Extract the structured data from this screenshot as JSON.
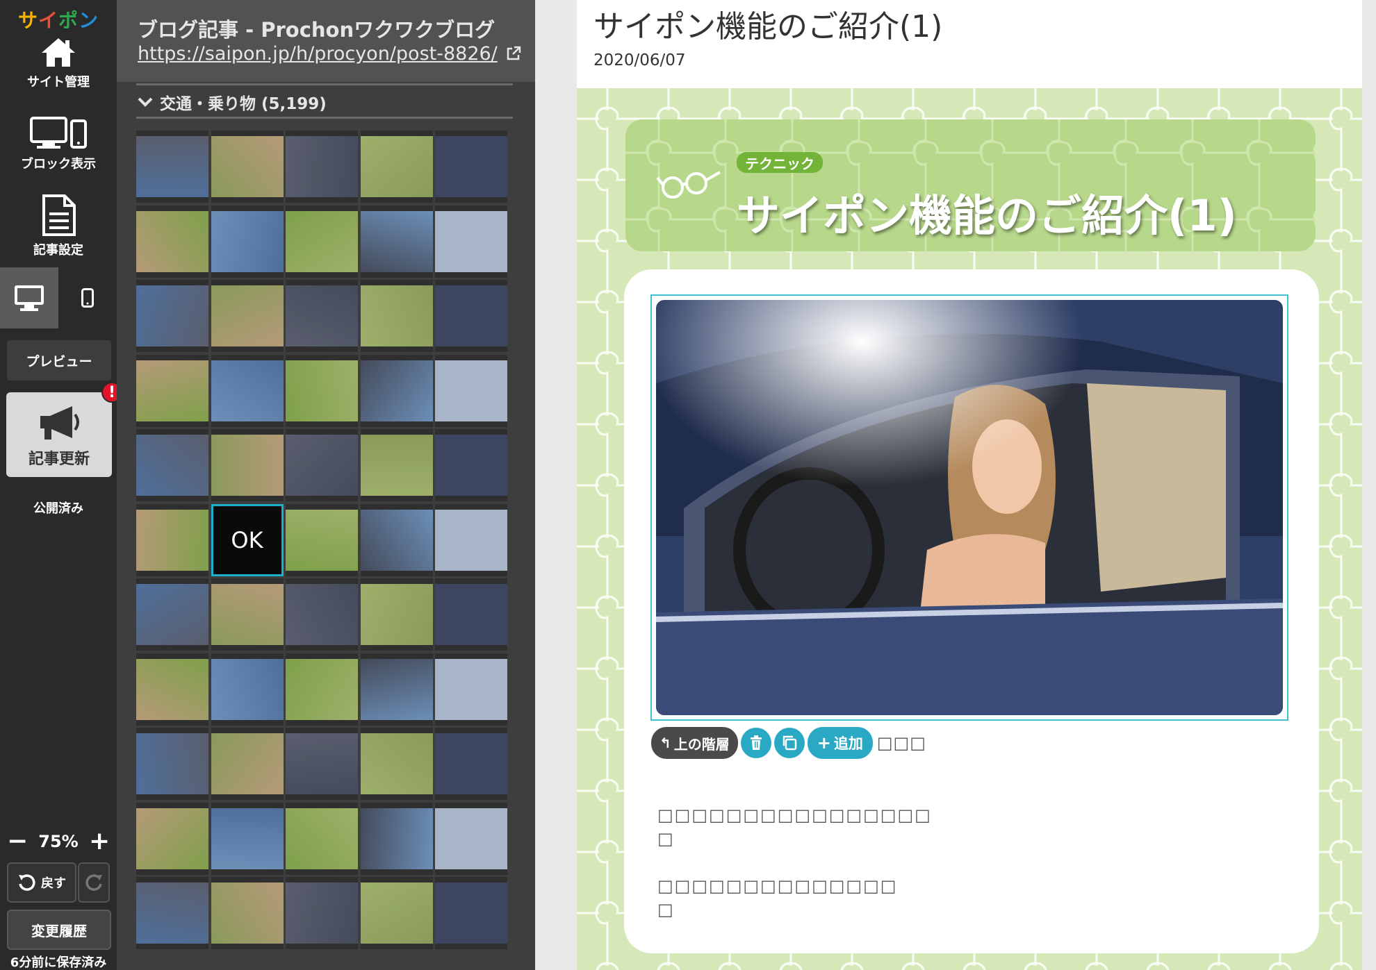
{
  "nav": {
    "logo": [
      "サ",
      "イ",
      "ポ",
      "ン"
    ],
    "site_manage": "サイト管理",
    "block_view": "ブロック表示",
    "article_settings": "記事設定",
    "preview": "プレビュー",
    "update": "記事更新",
    "alert": "!",
    "status": "公開済み",
    "zoom": "75%",
    "undo": "戻す",
    "history": "変更履歴",
    "saved": "6分前に保存済み"
  },
  "panel": {
    "blog_title": "ブログ記事 - Prochonワクワクブログ",
    "blog_url": "https://saipon.jp/h/procyon/post-8826/",
    "category": "交通・乗り物 (5,199)",
    "selected_label": "OK"
  },
  "preview": {
    "article_title": "サイポン機能のご紹介(1)",
    "date": "2020/06/07",
    "banner_tag": "テクニック",
    "banner_title": "サイポン機能のご紹介(1)",
    "toolbar": {
      "up": "上の階層",
      "add": "追加",
      "tail": "□□□"
    },
    "body_lines": [
      "□□□□□□□□□□□□□□□□",
      "□",
      "□□□□□□□□□□□□□□",
      "□"
    ]
  },
  "colors": {
    "nav_bg": "#2a2a2a",
    "panel_bg": "#3e3e3e",
    "accent": "#29a9c4",
    "preview_bg": "#d6e8b7",
    "banner": "#b7d88a",
    "alert": "#e0142a"
  },
  "icons": [
    "home-icon",
    "monitor-phone-icon",
    "document-icon",
    "monitor-icon",
    "phone-icon",
    "megaphone-icon",
    "undo-icon",
    "redo-icon",
    "chevron-down-icon",
    "external-link-icon",
    "trash-icon",
    "copy-icon",
    "glasses-icon"
  ]
}
